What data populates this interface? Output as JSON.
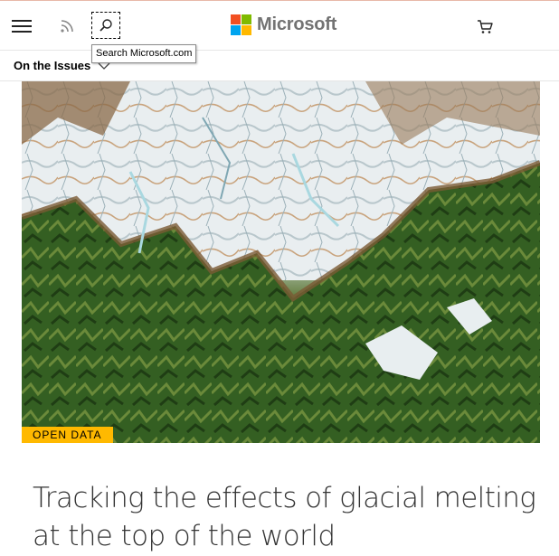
{
  "header": {
    "brand": "Microsoft",
    "brand_colors": [
      "#f25022",
      "#7fba00",
      "#00a4ef",
      "#ffb900"
    ],
    "icons": [
      "menu-icon",
      "rss-icon",
      "search-icon",
      "cart-icon"
    ],
    "search_tooltip": "Search Microsoft.com"
  },
  "subnav": {
    "label": "On the Issues"
  },
  "article": {
    "badge": "OPEN DATA",
    "badge_color": "#ffb900",
    "title": "Tracking the effects of glacial melting at the top of the world",
    "image_description": "satellite image of glaciers and forested mountains"
  }
}
